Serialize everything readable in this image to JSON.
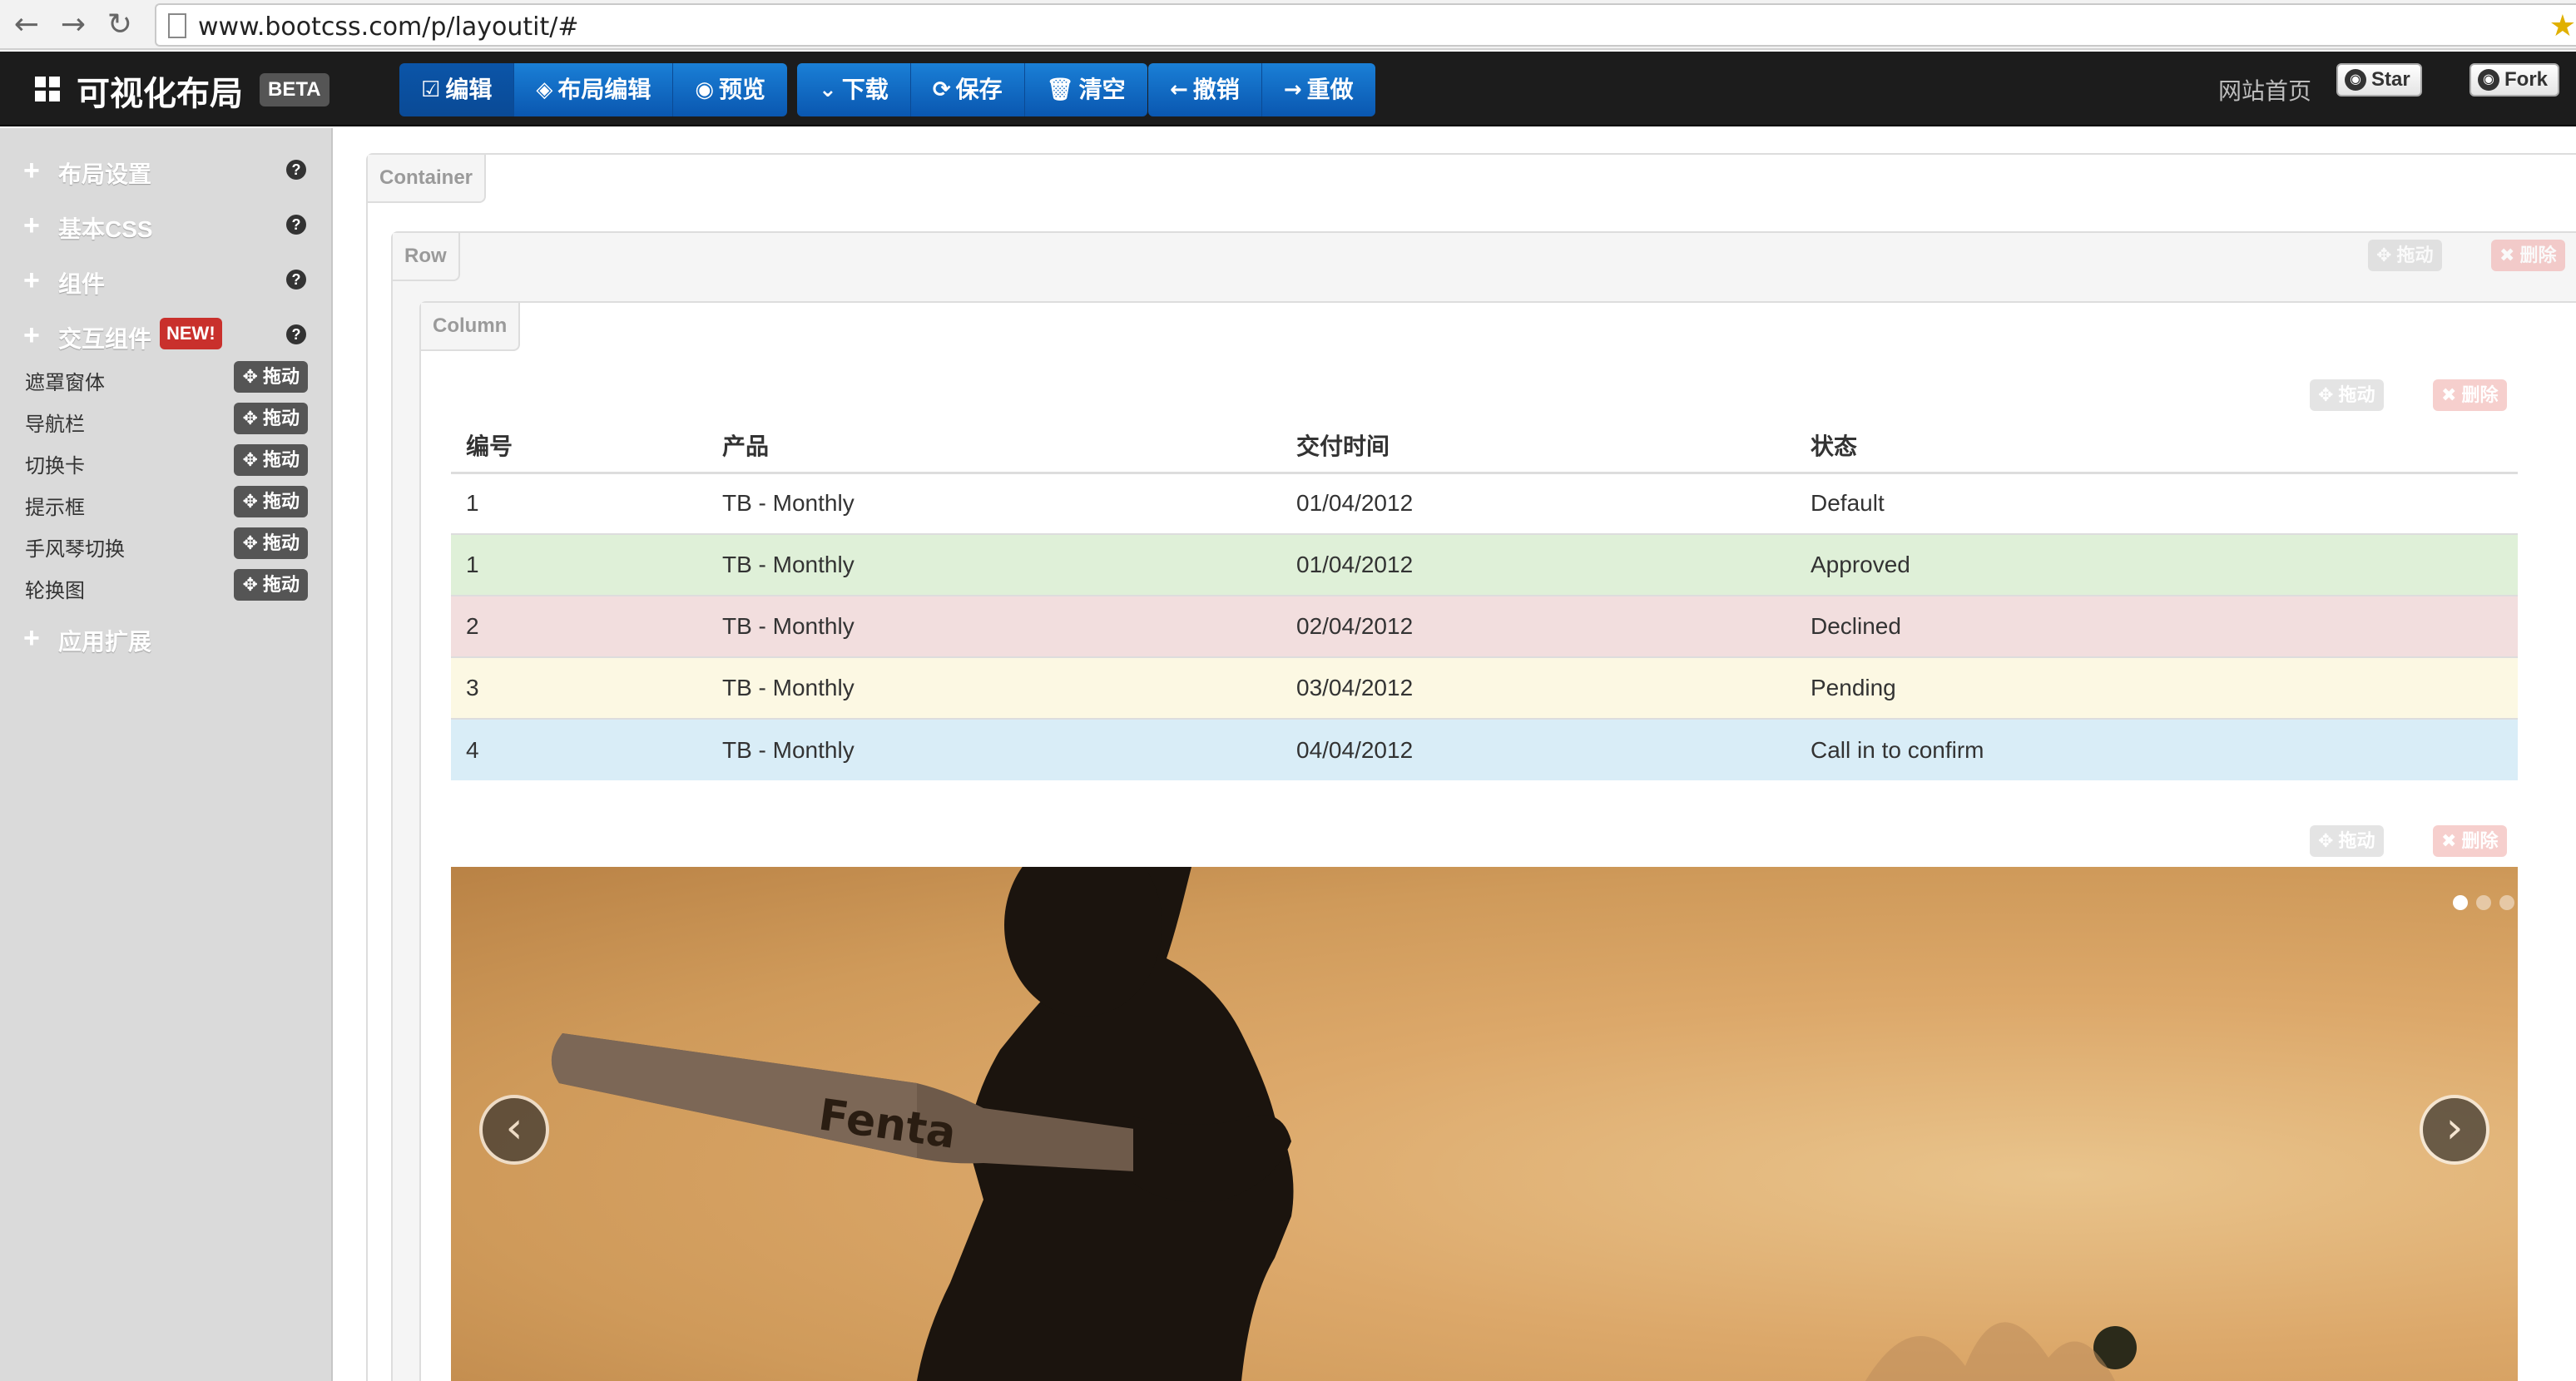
{
  "browser": {
    "url": "www.bootcss.com/p/layoutit/#",
    "back_icon": "back-arrow-icon",
    "forward_icon": "forward-arrow-icon",
    "reload_icon": "reload-icon"
  },
  "navbar": {
    "brand": "可视化布局",
    "beta": "BETA",
    "edit_group": [
      {
        "label": "编辑",
        "icon": "edit-icon",
        "glyph": "☑"
      },
      {
        "label": "布局编辑",
        "icon": "layout-edit-icon",
        "glyph": "◈"
      },
      {
        "label": "预览",
        "icon": "eye-icon",
        "glyph": "◉"
      }
    ],
    "file_group": [
      {
        "label": "下载",
        "icon": "chevron-down-icon",
        "glyph": "⌄"
      },
      {
        "label": "保存",
        "icon": "share-icon",
        "glyph": "⟳"
      },
      {
        "label": "清空",
        "icon": "trash-icon",
        "glyph": "🗑"
      }
    ],
    "history_group": [
      {
        "label": "撤销",
        "icon": "arrow-left-icon",
        "glyph": "←"
      },
      {
        "label": "重做",
        "icon": "arrow-right-icon",
        "glyph": "→"
      }
    ],
    "home_link": "网站首页",
    "star_label": "Star",
    "fork_label": "Fork"
  },
  "sidebar": {
    "sections": [
      {
        "label": "布局设置"
      },
      {
        "label": "基本CSS"
      },
      {
        "label": "组件"
      },
      {
        "label": "交互组件",
        "badge": "NEW!"
      }
    ],
    "components": [
      {
        "label": "遮罩窗体",
        "drag": "拖动"
      },
      {
        "label": "导航栏",
        "drag": "拖动"
      },
      {
        "label": "切换卡",
        "drag": "拖动"
      },
      {
        "label": "提示框",
        "drag": "拖动"
      },
      {
        "label": "手风琴切换",
        "drag": "拖动"
      },
      {
        "label": "轮换图",
        "drag": "拖动"
      }
    ],
    "extensions": {
      "label": "应用扩展"
    }
  },
  "canvas": {
    "container_label": "Container",
    "row_label": "Row",
    "column_label": "Column",
    "drag_label": "拖动",
    "delete_label": "删除"
  },
  "table": {
    "headers": [
      "编号",
      "产品",
      "交付时间",
      "状态"
    ],
    "rows": [
      {
        "state": "default",
        "cells": [
          "1",
          "TB - Monthly",
          "01/04/2012",
          "Default"
        ]
      },
      {
        "state": "success",
        "cells": [
          "1",
          "TB - Monthly",
          "01/04/2012",
          "Approved"
        ]
      },
      {
        "state": "error",
        "cells": [
          "2",
          "TB - Monthly",
          "02/04/2012",
          "Declined"
        ]
      },
      {
        "state": "warning",
        "cells": [
          "3",
          "TB - Monthly",
          "03/04/2012",
          "Pending"
        ]
      },
      {
        "state": "info",
        "cells": [
          "4",
          "TB - Monthly",
          "04/04/2012",
          "Call in to confirm"
        ]
      }
    ]
  },
  "carousel": {
    "slide_count": 3,
    "active_index": 0,
    "bat_text": "Fenta",
    "prev_glyph": "‹",
    "next_glyph": "›"
  },
  "colors": {
    "toolbar_blue": "#0a63c2",
    "navbar_bg": "#1c1c1c",
    "sidebar_bg": "#dadada",
    "success_row": "#dff0d8",
    "error_row": "#f2dede",
    "warning_row": "#fcf8e3",
    "info_row": "#d9edf7",
    "new_badge": "#c9302c"
  }
}
